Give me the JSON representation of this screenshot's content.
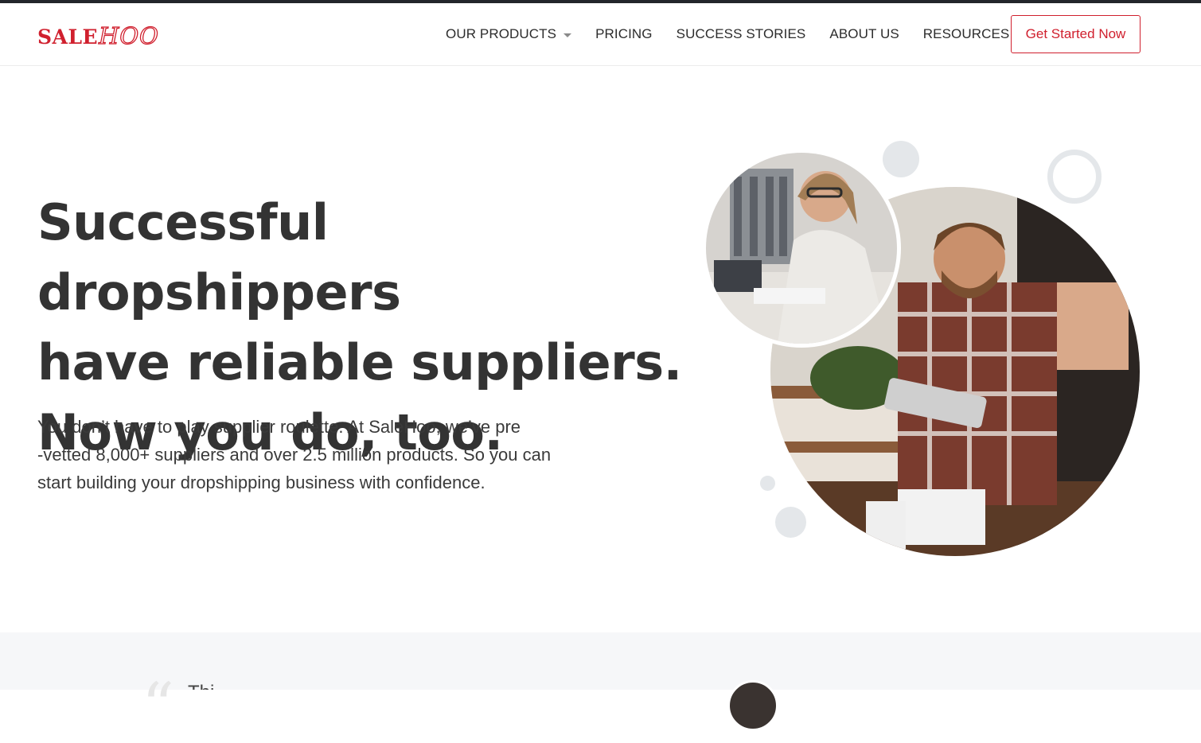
{
  "brand": {
    "part1": "SALE",
    "part2": "HOO",
    "color": "#d0202e"
  },
  "nav": {
    "items": [
      {
        "label": "OUR PRODUCTS",
        "has_dropdown": true
      },
      {
        "label": "PRICING",
        "has_dropdown": false
      },
      {
        "label": "SUCCESS STORIES",
        "has_dropdown": false
      },
      {
        "label": "ABOUT US",
        "has_dropdown": false
      },
      {
        "label": "RESOURCES",
        "has_dropdown": true
      }
    ],
    "cta_label": "Get Started Now"
  },
  "hero": {
    "heading_lines": [
      "Successful dropshippers",
      "have reliable suppliers.",
      "Now you do, too."
    ],
    "lede_lines": [
      "You don’t have to play supplier roulette. At SaleHoo, we’ve pre",
      "-vetted 8,000+ suppliers and over 2.5 million products. So you can",
      "start building your dropshipping business with confidence."
    ],
    "images": {
      "small": "woman-smiling-at-desk-photo",
      "large": "man-with-tablet-and-phone-photo"
    }
  },
  "testimonial": {
    "quote_mark": "“",
    "text_partial": "Thi"
  },
  "colors": {
    "heading": "#333333",
    "accent": "#d0202e",
    "bubble": "#e4e7ea",
    "band": "#f6f7f9"
  }
}
